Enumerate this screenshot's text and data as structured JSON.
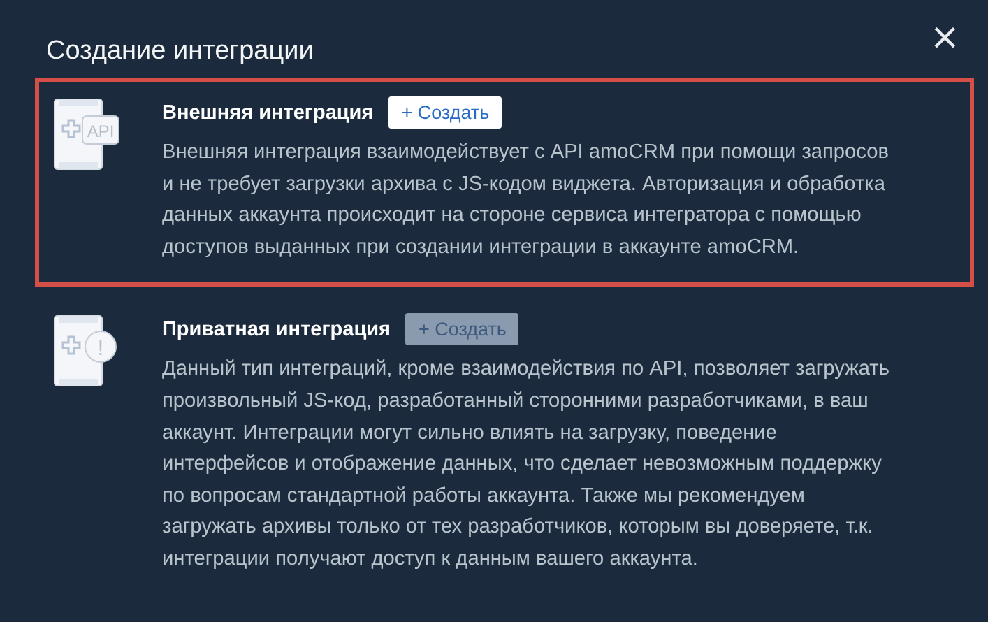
{
  "dialog": {
    "title": "Создание интеграции",
    "close": "×"
  },
  "options": [
    {
      "kind": "api",
      "badge": "API",
      "title": "Внешняя интеграция",
      "button": "+ Создать",
      "disabled": false,
      "highlighted": true,
      "description": "Внешняя интеграция взаимодействует с API amoCRM при помощи запросов\nи не требует загрузки архива с JS-кодом виджета. Авторизация и обработка\nданных аккаунта происходит на стороне сервиса интегратора с помощью\nдоступов выданных при создании интеграции в аккаунте amoCRM."
    },
    {
      "kind": "private",
      "badge": "!",
      "title": "Приватная интеграция",
      "button": "+ Создать",
      "disabled": true,
      "highlighted": false,
      "description": "Данный тип интеграций, кроме взаимодействия по API, позволяет загружать\nпроизвольный JS-код, разработанный сторонними разработчиками, в ваш\nаккаунт. Интеграции могут сильно влиять на загрузку, поведение\nинтерфейсов и отображение данных, что сделает невозможным поддержку\nпо вопросам стандартной работы аккаунта. Также мы рекомендуем\nзагружать архивы только от тех разработчиков, которым вы доверяете, т.к.\nинтеграции получают доступ к данным вашего аккаунта."
    }
  ]
}
